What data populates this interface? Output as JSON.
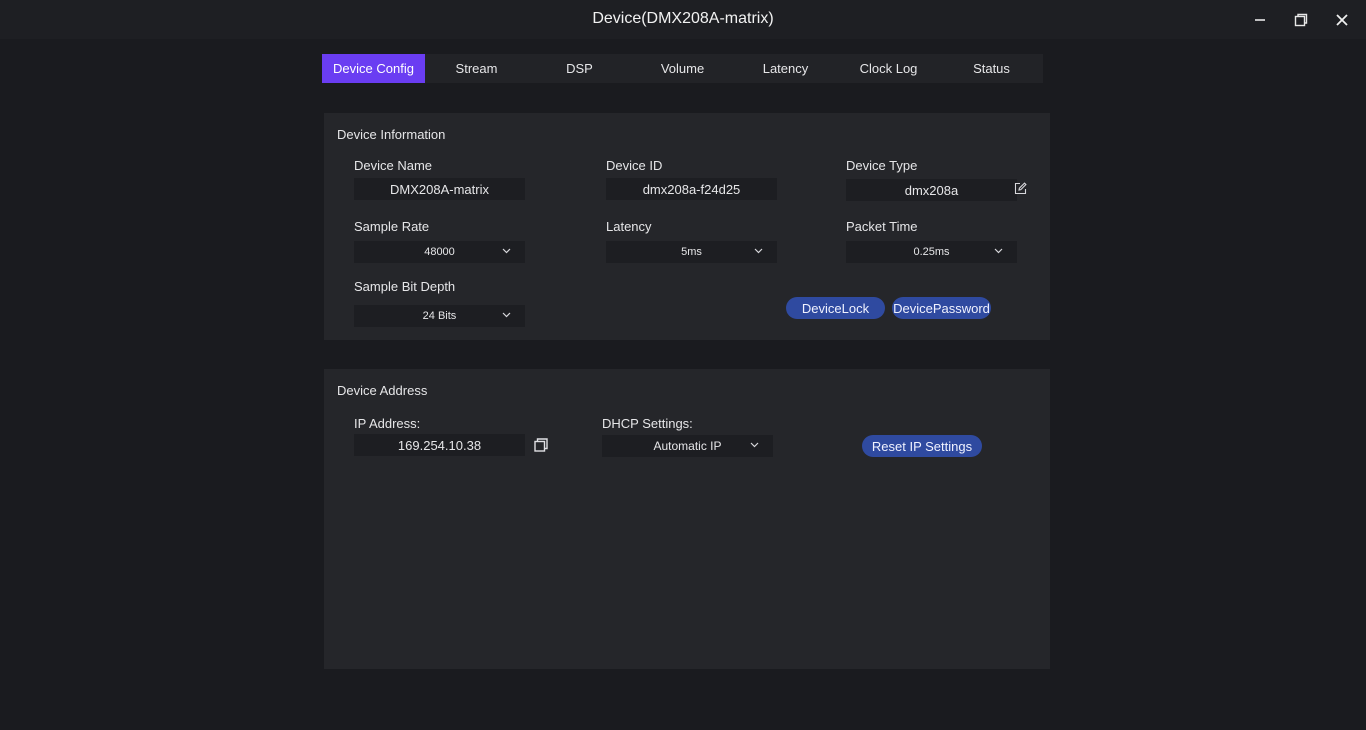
{
  "window": {
    "title": "Device(DMX208A-matrix)"
  },
  "tabs": [
    {
      "label": "Device Config"
    },
    {
      "label": "Stream"
    },
    {
      "label": "DSP"
    },
    {
      "label": "Volume"
    },
    {
      "label": "Latency"
    },
    {
      "label": "Clock Log"
    },
    {
      "label": "Status"
    }
  ],
  "active_tab": "Device Config",
  "device_info": {
    "title": "Device Information",
    "device_name": {
      "label": "Device Name",
      "value": "DMX208A-matrix"
    },
    "device_id": {
      "label": "Device ID",
      "value": "dmx208a-f24d25"
    },
    "device_type": {
      "label": "Device Type",
      "value": "dmx208a"
    },
    "sample_rate": {
      "label": "Sample Rate",
      "value": "48000"
    },
    "latency": {
      "label": "Latency",
      "value": "5ms"
    },
    "packet_time": {
      "label": "Packet Time",
      "value": "0.25ms"
    },
    "bit_depth": {
      "label": "Sample Bit Depth",
      "value": "24 Bits"
    },
    "device_lock_label": "DeviceLock",
    "device_password_label": "DevicePassword"
  },
  "device_address": {
    "title": "Device Address",
    "ip": {
      "label": "IP Address:",
      "value": "169.254.10.38"
    },
    "dhcp": {
      "label": "DHCP Settings:",
      "value": "Automatic IP"
    },
    "reset_label": "Reset IP Settings"
  },
  "colors": {
    "accent": "#6a3df2",
    "pill": "#2f4aa0",
    "background": "#1a1b1f",
    "panel": "#25262a"
  }
}
